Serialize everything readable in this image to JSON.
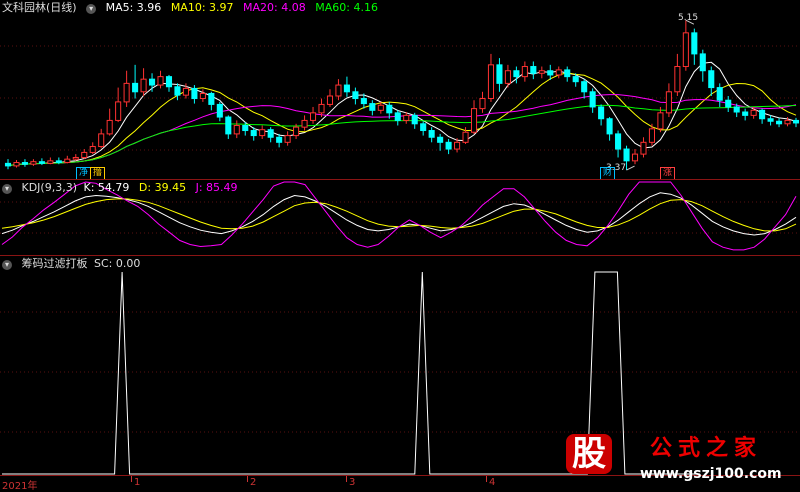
{
  "window": {
    "title": "文科园林(日线)"
  },
  "price_panel": {
    "ma_labels": [
      {
        "text": "MA5: 3.96",
        "color": "#ffffff"
      },
      {
        "text": "MA10: 3.97",
        "color": "#ffff00"
      },
      {
        "text": "MA20: 4.08",
        "color": "#ff00ff"
      },
      {
        "text": "MA60: 4.16",
        "color": "#00ff00"
      }
    ],
    "high_marker": "5.15",
    "low_marker": "3.37",
    "tags": [
      {
        "text": "净",
        "color": "#00bfff"
      },
      {
        "text": "撸",
        "color": "#ffcc00"
      },
      {
        "text": "财",
        "color": "#00bfff"
      },
      {
        "text": "涨",
        "color": "#ff4040"
      }
    ]
  },
  "kdj_panel": {
    "name": "KDJ(9,3,3)",
    "k_label": "K: 54.79",
    "d_label": "D: 39.45",
    "j_label": "J: 85.49"
  },
  "sc_panel": {
    "name": "筹码过滤打板",
    "sc_label": "SC: 0.00"
  },
  "x_axis": {
    "labels": [
      "2021年",
      "1",
      "2",
      "3",
      "4"
    ]
  },
  "watermark": {
    "logo_char": "股",
    "title": "公式之家",
    "url": "www.gszj100.com"
  },
  "colors": {
    "up": "#ff3232",
    "down": "#00ffff",
    "k": "#ffffff",
    "d": "#ffff00",
    "j": "#ff00ff",
    "ma60": "#00ff00",
    "divider": "#8a1414"
  },
  "chart_data": [
    {
      "type": "candlestick",
      "title": "文科园林(日线)",
      "ylim": [
        3.3,
        5.2
      ],
      "candles": [
        [
          3.45,
          3.42,
          3.5,
          3.38
        ],
        [
          3.42,
          3.46,
          3.49,
          3.4
        ],
        [
          3.46,
          3.44,
          3.5,
          3.41
        ],
        [
          3.44,
          3.47,
          3.5,
          3.42
        ],
        [
          3.47,
          3.45,
          3.51,
          3.43
        ],
        [
          3.45,
          3.48,
          3.52,
          3.44
        ],
        [
          3.48,
          3.46,
          3.52,
          3.44
        ],
        [
          3.46,
          3.5,
          3.54,
          3.45
        ],
        [
          3.5,
          3.52,
          3.56,
          3.48
        ],
        [
          3.52,
          3.58,
          3.62,
          3.5
        ],
        [
          3.58,
          3.65,
          3.7,
          3.56
        ],
        [
          3.65,
          3.8,
          3.86,
          3.63
        ],
        [
          3.8,
          3.96,
          4.1,
          3.78
        ],
        [
          3.96,
          4.18,
          4.35,
          3.94
        ],
        [
          4.18,
          4.4,
          4.55,
          4.12
        ],
        [
          4.4,
          4.3,
          4.62,
          4.22
        ],
        [
          4.3,
          4.45,
          4.58,
          4.25
        ],
        [
          4.45,
          4.38,
          4.52,
          4.3
        ],
        [
          4.38,
          4.48,
          4.55,
          4.34
        ],
        [
          4.48,
          4.36,
          4.5,
          4.3
        ],
        [
          4.36,
          4.26,
          4.4,
          4.2
        ],
        [
          4.26,
          4.34,
          4.4,
          4.22
        ],
        [
          4.34,
          4.22,
          4.38,
          4.16
        ],
        [
          4.22,
          4.28,
          4.33,
          4.18
        ],
        [
          4.28,
          4.15,
          4.3,
          4.08
        ],
        [
          4.15,
          4.0,
          4.18,
          3.95
        ],
        [
          4.0,
          3.8,
          4.02,
          3.74
        ],
        [
          3.8,
          3.9,
          3.96,
          3.75
        ],
        [
          3.9,
          3.84,
          3.94,
          3.78
        ],
        [
          3.84,
          3.78,
          3.88,
          3.72
        ],
        [
          3.78,
          3.85,
          3.9,
          3.74
        ],
        [
          3.85,
          3.76,
          3.88,
          3.7
        ],
        [
          3.76,
          3.7,
          3.8,
          3.64
        ],
        [
          3.7,
          3.78,
          3.83,
          3.66
        ],
        [
          3.78,
          3.88,
          3.92,
          3.74
        ],
        [
          3.88,
          3.96,
          4.02,
          3.84
        ],
        [
          3.96,
          4.05,
          4.12,
          3.92
        ],
        [
          4.05,
          4.15,
          4.22,
          4.0
        ],
        [
          4.15,
          4.25,
          4.33,
          4.12
        ],
        [
          4.25,
          4.38,
          4.45,
          4.2
        ],
        [
          4.38,
          4.3,
          4.48,
          4.24
        ],
        [
          4.3,
          4.22,
          4.35,
          4.15
        ],
        [
          4.22,
          4.16,
          4.28,
          4.1
        ],
        [
          4.16,
          4.08,
          4.2,
          4.02
        ],
        [
          4.08,
          4.14,
          4.18,
          4.04
        ],
        [
          4.14,
          4.05,
          4.18,
          3.98
        ],
        [
          4.05,
          3.96,
          4.08,
          3.9
        ],
        [
          3.96,
          4.02,
          4.06,
          3.92
        ],
        [
          4.02,
          3.92,
          4.05,
          3.86
        ],
        [
          3.92,
          3.84,
          3.95,
          3.78
        ],
        [
          3.84,
          3.76,
          3.88,
          3.7
        ],
        [
          3.76,
          3.7,
          3.8,
          3.6
        ],
        [
          3.7,
          3.62,
          3.74,
          3.56
        ],
        [
          3.62,
          3.7,
          3.75,
          3.58
        ],
        [
          3.7,
          3.82,
          3.88,
          3.68
        ],
        [
          3.82,
          4.1,
          4.2,
          3.8
        ],
        [
          4.1,
          4.22,
          4.3,
          4.05
        ],
        [
          4.22,
          4.62,
          4.75,
          4.18
        ],
        [
          4.62,
          4.4,
          4.7,
          4.3
        ],
        [
          4.4,
          4.55,
          4.62,
          4.35
        ],
        [
          4.55,
          4.48,
          4.6,
          4.4
        ],
        [
          4.48,
          4.6,
          4.66,
          4.42
        ],
        [
          4.6,
          4.52,
          4.66,
          4.45
        ],
        [
          4.52,
          4.55,
          4.6,
          4.46
        ],
        [
          4.55,
          4.5,
          4.62,
          4.44
        ],
        [
          4.5,
          4.56,
          4.6,
          4.46
        ],
        [
          4.56,
          4.48,
          4.6,
          4.42
        ],
        [
          4.48,
          4.42,
          4.52,
          4.36
        ],
        [
          4.42,
          4.3,
          4.45,
          4.22
        ],
        [
          4.3,
          4.12,
          4.34,
          4.05
        ],
        [
          4.12,
          3.98,
          4.15,
          3.9
        ],
        [
          3.98,
          3.8,
          4.0,
          3.72
        ],
        [
          3.8,
          3.62,
          3.84,
          3.52
        ],
        [
          3.62,
          3.48,
          3.66,
          3.37
        ],
        [
          3.48,
          3.56,
          3.62,
          3.44
        ],
        [
          3.56,
          3.7,
          3.76,
          3.52
        ],
        [
          3.7,
          3.86,
          3.92,
          3.66
        ],
        [
          3.86,
          4.05,
          4.12,
          3.82
        ],
        [
          4.05,
          4.3,
          4.4,
          4.0
        ],
        [
          4.3,
          4.6,
          4.75,
          4.25
        ],
        [
          4.6,
          5.0,
          5.15,
          4.55
        ],
        [
          5.0,
          4.75,
          5.05,
          4.62
        ],
        [
          4.75,
          4.55,
          4.8,
          4.42
        ],
        [
          4.55,
          4.35,
          4.6,
          4.25
        ],
        [
          4.35,
          4.2,
          4.4,
          4.12
        ],
        [
          4.2,
          4.12,
          4.25,
          4.06
        ],
        [
          4.12,
          4.06,
          4.16,
          4.0
        ],
        [
          4.06,
          4.02,
          4.1,
          3.96
        ],
        [
          4.02,
          4.08,
          4.12,
          3.98
        ],
        [
          4.08,
          3.98,
          4.1,
          3.92
        ],
        [
          3.98,
          3.95,
          4.02,
          3.9
        ],
        [
          3.95,
          3.92,
          3.99,
          3.88
        ],
        [
          3.92,
          3.96,
          4.0,
          3.89
        ],
        [
          3.96,
          3.93,
          3.99,
          3.88
        ]
      ]
    },
    {
      "type": "line",
      "title": "KDJ(9,3,3)",
      "ylim": [
        0,
        100
      ],
      "series": [
        {
          "name": "K",
          "values": [
            30,
            35,
            42,
            48,
            55,
            62,
            70,
            78,
            84,
            86,
            85,
            83,
            80,
            76,
            70,
            62,
            54,
            46,
            40,
            35,
            32,
            30,
            34,
            40,
            48,
            58,
            70,
            80,
            86,
            84,
            78,
            70,
            60,
            50,
            42,
            36,
            34,
            36,
            40,
            44,
            42,
            38,
            34,
            36,
            40,
            46,
            54,
            62,
            70,
            74,
            72,
            66,
            58,
            50,
            42,
            36,
            32,
            34,
            40,
            50,
            62,
            74,
            84,
            90,
            88,
            82,
            72,
            60,
            48,
            40,
            34,
            30,
            28,
            30,
            36,
            44,
            54
          ]
        },
        {
          "name": "D",
          "values": [
            38,
            40,
            43,
            46,
            50,
            55,
            61,
            67,
            73,
            77,
            80,
            81,
            81,
            79,
            76,
            71,
            65,
            59,
            53,
            47,
            42,
            38,
            37,
            38,
            41,
            47,
            55,
            63,
            71,
            75,
            76,
            74,
            69,
            63,
            56,
            49,
            44,
            41,
            40,
            41,
            42,
            41,
            39,
            38,
            39,
            41,
            45,
            51,
            57,
            63,
            66,
            66,
            63,
            59,
            53,
            47,
            42,
            39,
            39,
            43,
            49,
            57,
            66,
            74,
            79,
            80,
            77,
            71,
            63,
            55,
            48,
            42,
            37,
            34,
            34,
            37,
            44
          ]
        },
        {
          "name": "J",
          "values": [
            14,
            25,
            40,
            52,
            65,
            76,
            88,
            100,
            106,
            104,
            95,
            87,
            78,
            70,
            58,
            44,
            32,
            20,
            14,
            11,
            12,
            14,
            28,
            44,
            62,
            80,
            100,
            114,
            116,
            102,
            82,
            62,
            42,
            24,
            14,
            10,
            14,
            26,
            40,
            50,
            42,
            32,
            24,
            32,
            42,
            56,
            72,
            84,
            96,
            96,
            84,
            66,
            48,
            32,
            20,
            14,
            12,
            24,
            42,
            64,
            88,
            108,
            120,
            122,
            106,
            86,
            62,
            38,
            18,
            10,
            6,
            6,
            10,
            22,
            40,
            58,
            85
          ]
        }
      ]
    },
    {
      "type": "line",
      "title": "筹码过滤打板",
      "ylim": [
        0,
        1
      ],
      "series": [
        {
          "name": "SC",
          "values": [
            0,
            0,
            0,
            0,
            0,
            0,
            0,
            0,
            0,
            0,
            0,
            0,
            0,
            0,
            0,
            0,
            1,
            0,
            0,
            0,
            0,
            0,
            0,
            0,
            0,
            0,
            0,
            0,
            0,
            0,
            0,
            0,
            0,
            0,
            0,
            0,
            0,
            0,
            0,
            0,
            0,
            0,
            0,
            0,
            0,
            0,
            0,
            0,
            0,
            0,
            0,
            0,
            0,
            0,
            0,
            0,
            1,
            0,
            0,
            0,
            0,
            0,
            0,
            0,
            0,
            0,
            0,
            0,
            0,
            0,
            0,
            0,
            0,
            0,
            0,
            0,
            0,
            0,
            0,
            1,
            1,
            1,
            1,
            0,
            0,
            0,
            0,
            0,
            0,
            0,
            0,
            0,
            0,
            0
          ]
        }
      ]
    }
  ]
}
